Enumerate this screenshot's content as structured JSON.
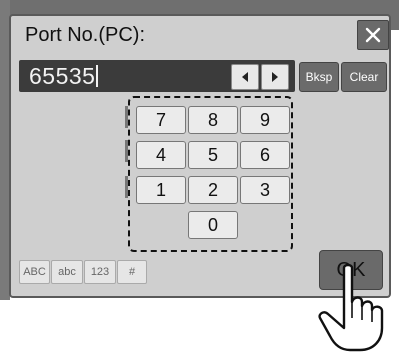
{
  "dialog": {
    "title": "Port No.(PC):",
    "close_icon": "close-icon"
  },
  "input": {
    "value": "65535"
  },
  "nav": {
    "left_icon": "arrow-left-icon",
    "right_icon": "arrow-right-icon"
  },
  "actions": {
    "backspace_label": "Bksp",
    "clear_label": "Clear",
    "ok_label": "OK"
  },
  "keypad": {
    "keys": [
      "7",
      "8",
      "9",
      "4",
      "5",
      "6",
      "1",
      "2",
      "3",
      "0"
    ]
  },
  "modes": [
    "ABC",
    "abc",
    "123",
    "#"
  ],
  "colors": {
    "dialog_bg": "#cfcfcf",
    "input_bg": "#3b3b3b",
    "dark_button": "#6a6a6a",
    "key_bg": "#ebebeb"
  },
  "pointer": {
    "icon": "hand-pointer-icon"
  }
}
